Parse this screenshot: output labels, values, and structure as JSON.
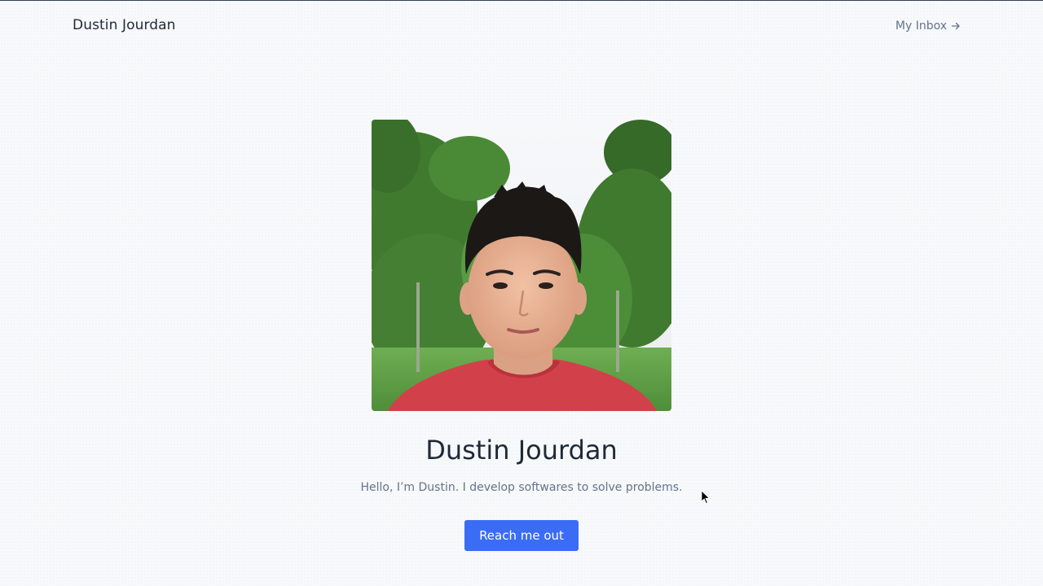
{
  "header": {
    "brand": "Dustin Jourdan",
    "inbox_label": "My Inbox"
  },
  "profile": {
    "photo_icon": "portrait-photo",
    "name": "Dustin Jourdan",
    "tagline": "Hello, I’m Dustin. I develop softwares to solve problems.",
    "cta_label": "Reach me out"
  },
  "colors": {
    "accent": "#3b6cf6",
    "text_dark": "#1f2937",
    "text_muted": "#64748b",
    "background": "#f7f9fb"
  }
}
